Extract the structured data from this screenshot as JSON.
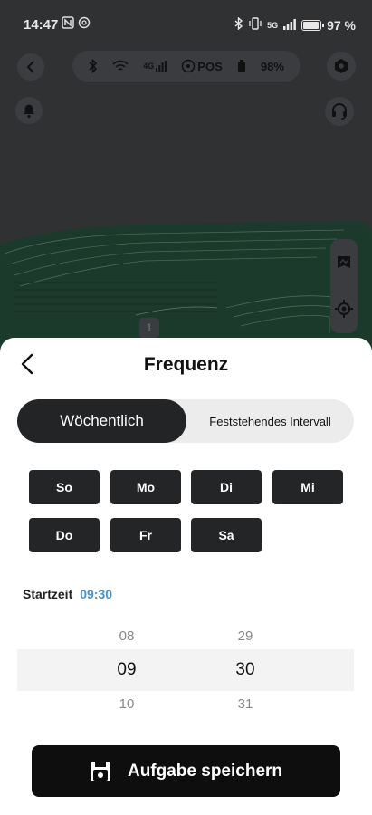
{
  "status_bar": {
    "time": "14:47",
    "left_icons": [
      "nfc-icon",
      "threads-icon"
    ],
    "network": "5G",
    "battery": "97 %"
  },
  "device_bar": {
    "items": [
      "bluetooth-icon",
      "wifi-icon",
      "4g-signal-icon",
      "pos-icon",
      "battery-icon"
    ],
    "network_label": "4G",
    "pos_label": "POS",
    "battery": "98%"
  },
  "map": {
    "badge": "1"
  },
  "sheet": {
    "title": "Frequenz",
    "tabs": [
      {
        "label": "Wöchentlich",
        "active": true
      },
      {
        "label": "Feststehendes Intervall",
        "active": false
      }
    ],
    "days": [
      "So",
      "Mo",
      "Di",
      "Mi",
      "Do",
      "Fr",
      "Sa"
    ],
    "start_time_label": "Startzeit",
    "start_time_value": "09:30",
    "hours": [
      "08",
      "09",
      "10"
    ],
    "minutes": [
      "29",
      "30",
      "31"
    ],
    "save_label": "Aufgabe speichern"
  },
  "colors": {
    "accent_blue": "#4a90c8",
    "dark_button": "#232527",
    "map_green": "#1f3a2c"
  }
}
